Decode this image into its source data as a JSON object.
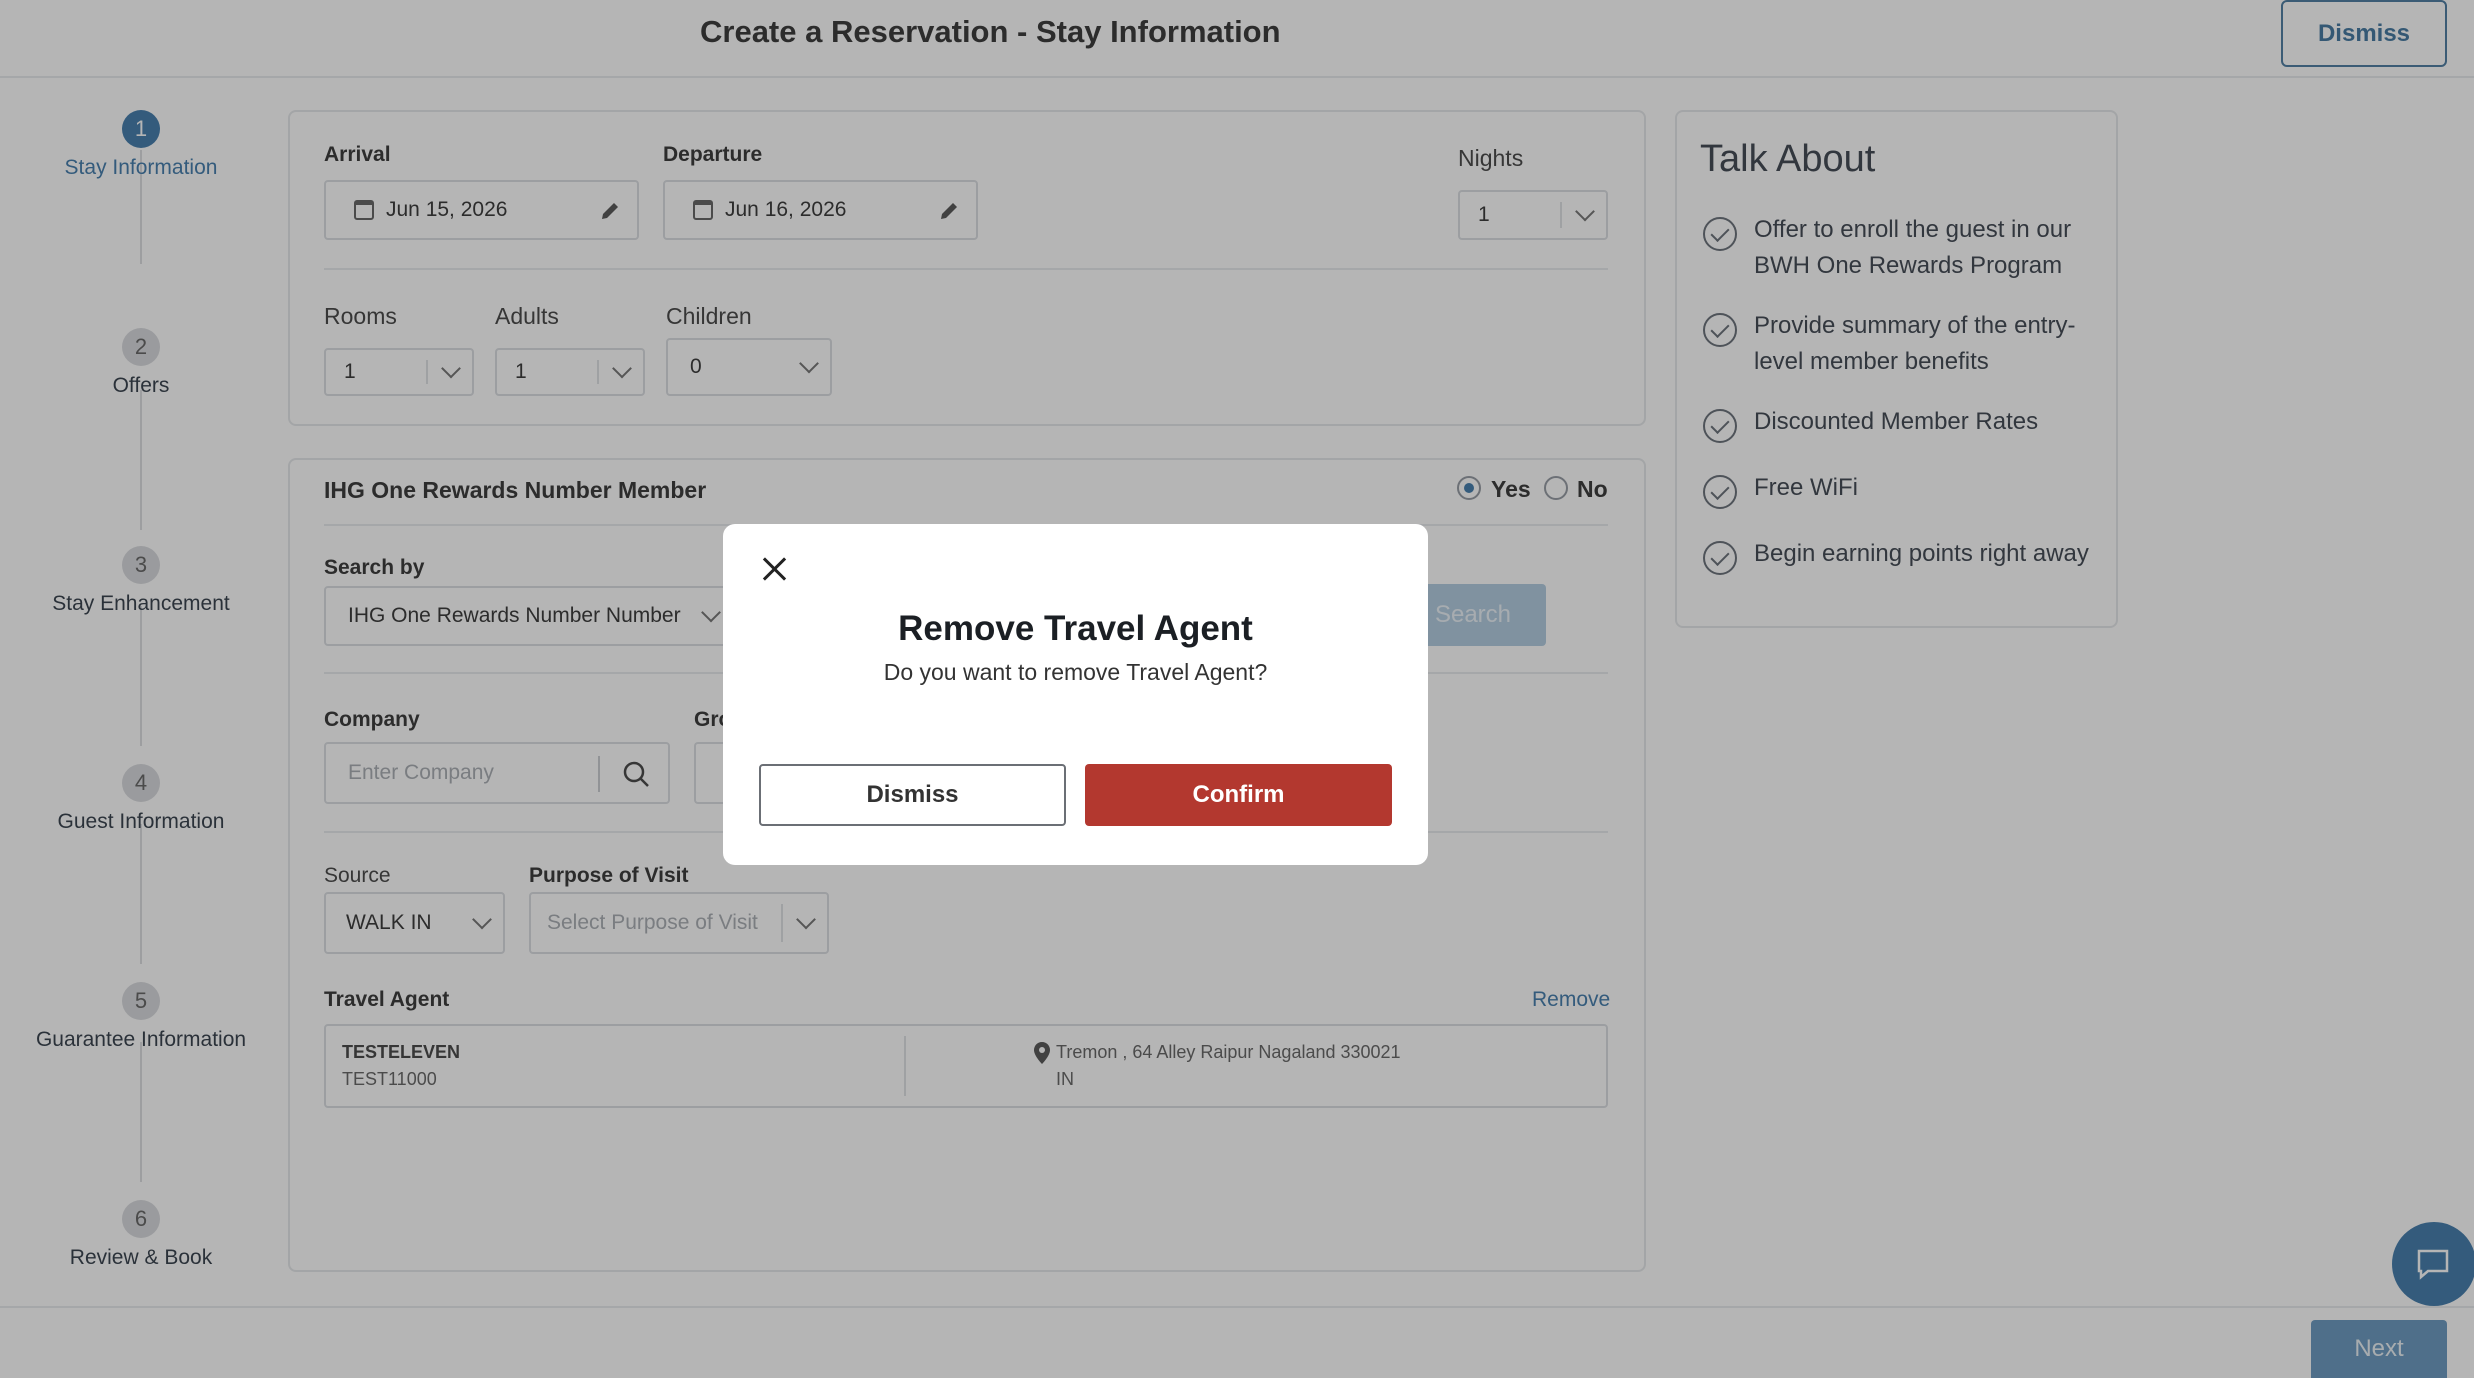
{
  "header": {
    "title": "Create a Reservation - Stay Information",
    "dismiss_label": "Dismiss"
  },
  "steps": [
    {
      "num": "1",
      "label": "Stay Information"
    },
    {
      "num": "2",
      "label": "Offers"
    },
    {
      "num": "3",
      "label": "Stay Enhancement"
    },
    {
      "num": "4",
      "label": "Guest Information"
    },
    {
      "num": "5",
      "label": "Guarantee Information"
    },
    {
      "num": "6",
      "label": "Review & Book"
    }
  ],
  "stay": {
    "arrival_label": "Arrival",
    "arrival_value": "Jun 15, 2026",
    "departure_label": "Departure",
    "departure_value": "Jun 16, 2026",
    "nights_label": "Nights",
    "nights_value": "1",
    "rooms_label": "Rooms",
    "rooms_value": "1",
    "adults_label": "Adults",
    "adults_value": "1",
    "children_label": "Children",
    "children_value": "0"
  },
  "member": {
    "title": "IHG One Rewards Number Member",
    "yes_label": "Yes",
    "no_label": "No",
    "search_by_label": "Search by",
    "search_by_value": "IHG One Rewards Number Number",
    "search_button": "Search",
    "company_label": "Company",
    "company_placeholder": "Enter Company",
    "group_label_partial": "Gro",
    "source_label": "Source",
    "source_value": "WALK IN",
    "purpose_label": "Purpose of Visit",
    "purpose_placeholder": "Select Purpose of Visit",
    "travel_agent_label": "Travel Agent",
    "remove_label": "Remove",
    "agent_name": "TESTELEVEN",
    "agent_id": "TEST11000",
    "agent_address": "Tremon , 64 Alley Raipur Nagaland 330021",
    "agent_country": "IN"
  },
  "talk": {
    "title": "Talk About",
    "items": [
      "Offer to enroll the guest in our BWH One Rewards Program",
      "Provide summary of the entry-level member benefits",
      "Discounted Member Rates",
      "Free WiFi",
      "Begin earning points right away"
    ]
  },
  "modal": {
    "title": "Remove Travel Agent",
    "message": "Do you want to remove Travel Agent?",
    "dismiss_label": "Dismiss",
    "confirm_label": "Confirm"
  },
  "footer": {
    "next_label": "Next"
  },
  "colors": {
    "primary": "#2f6fa4",
    "confirm": "#b3382f"
  }
}
